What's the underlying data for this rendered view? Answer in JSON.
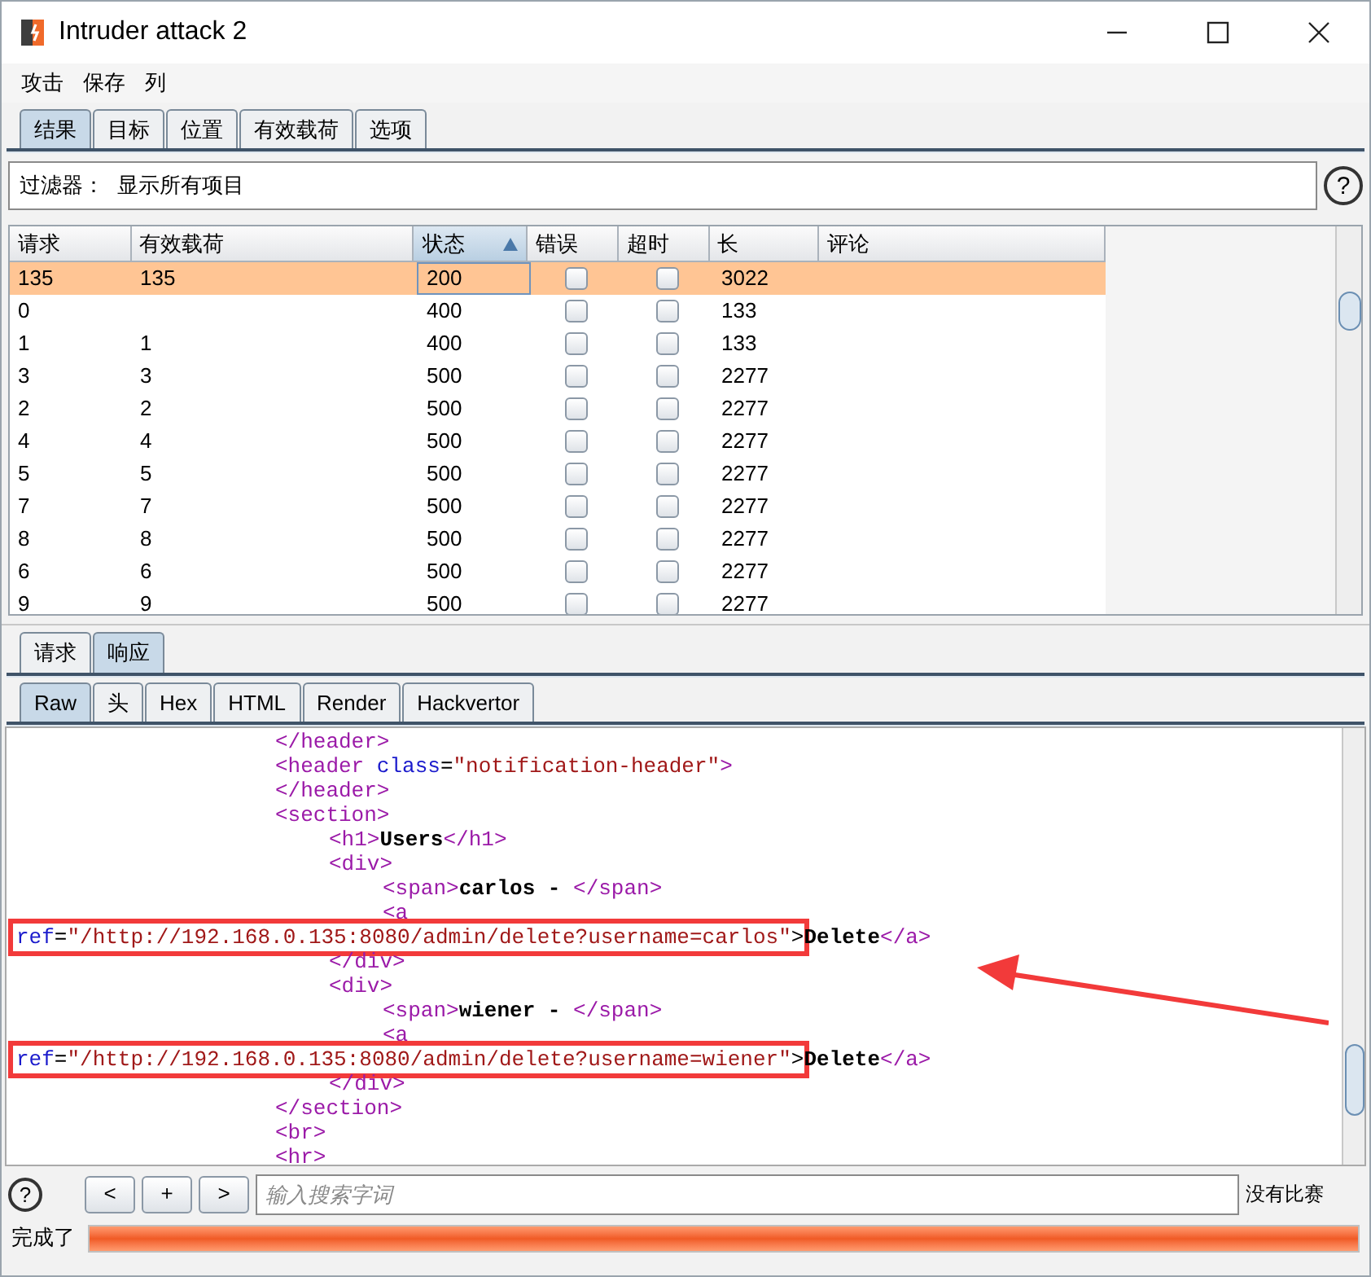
{
  "window": {
    "title": "Intruder attack 2"
  },
  "menu": [
    "攻击",
    "保存",
    "列"
  ],
  "main_tabs": [
    {
      "label": "结果",
      "selected": true
    },
    {
      "label": "目标",
      "selected": false
    },
    {
      "label": "位置",
      "selected": false
    },
    {
      "label": "有效载荷",
      "selected": false
    },
    {
      "label": "选项",
      "selected": false
    }
  ],
  "filter": {
    "label": "过滤器：",
    "value": "显示所有项目",
    "help": "?"
  },
  "table": {
    "columns": [
      {
        "label": "请求",
        "sorted": false
      },
      {
        "label": "有效载荷",
        "sorted": false
      },
      {
        "label": "状态",
        "sorted": true
      },
      {
        "label": "错误",
        "sorted": false
      },
      {
        "label": "超时",
        "sorted": false
      },
      {
        "label": "长",
        "sorted": false
      },
      {
        "label": "评论",
        "sorted": false
      }
    ],
    "rows": [
      {
        "request": "135",
        "payload": "135",
        "status": "200",
        "error": false,
        "timeout": false,
        "length": "3022",
        "selected": true
      },
      {
        "request": "0",
        "status": "400",
        "error": false,
        "timeout": false,
        "length": "133",
        "selected": false
      },
      {
        "request": "1",
        "payload": "1",
        "status": "400",
        "error": false,
        "timeout": false,
        "length": "133",
        "selected": false
      },
      {
        "request": "3",
        "payload": "3",
        "status": "500",
        "error": false,
        "timeout": false,
        "length": "2277",
        "selected": false
      },
      {
        "request": "2",
        "payload": "2",
        "status": "500",
        "error": false,
        "timeout": false,
        "length": "2277",
        "selected": false
      },
      {
        "request": "4",
        "payload": "4",
        "status": "500",
        "error": false,
        "timeout": false,
        "length": "2277",
        "selected": false
      },
      {
        "request": "5",
        "payload": "5",
        "status": "500",
        "error": false,
        "timeout": false,
        "length": "2277",
        "selected": false
      },
      {
        "request": "7",
        "payload": "7",
        "status": "500",
        "error": false,
        "timeout": false,
        "length": "2277",
        "selected": false
      },
      {
        "request": "8",
        "payload": "8",
        "status": "500",
        "error": false,
        "timeout": false,
        "length": "2277",
        "selected": false
      },
      {
        "request": "6",
        "payload": "6",
        "status": "500",
        "error": false,
        "timeout": false,
        "length": "2277",
        "selected": false
      },
      {
        "request": "9",
        "payload": "9",
        "status": "500",
        "error": false,
        "timeout": false,
        "length": "2277",
        "selected": false
      }
    ]
  },
  "message_tabs": [
    {
      "label": "请求",
      "selected": false
    },
    {
      "label": "响应",
      "selected": true
    }
  ],
  "view_tabs": [
    {
      "label": "Raw",
      "selected": true
    },
    {
      "label": "头",
      "selected": false
    },
    {
      "label": "Hex",
      "selected": false
    },
    {
      "label": "HTML",
      "selected": false
    },
    {
      "label": "Render",
      "selected": false
    },
    {
      "label": "Hackvertor",
      "selected": false
    }
  ],
  "code_lines": [
    {
      "kind": "line",
      "tokens": [
        {
          "kind": "tag",
          "t": "</header>"
        }
      ]
    },
    {
      "kind": "line",
      "tokens": [
        {
          "kind": "tag",
          "t": "<header "
        },
        {
          "kind": "attr",
          "t": "class"
        },
        {
          "kind": "plain",
          "t": "="
        },
        {
          "kind": "value",
          "t": "\"notification-header\""
        },
        {
          "kind": "tag",
          "t": ">"
        }
      ]
    },
    {
      "kind": "line",
      "tokens": [
        {
          "kind": "tag",
          "t": "</header>"
        }
      ]
    },
    {
      "kind": "line",
      "tokens": [
        {
          "kind": "tag",
          "t": "<section>"
        }
      ],
      "children": [
        {
          "tokens": [
            {
              "kind": "tag",
              "t": "<h1>"
            },
            {
              "kind": "bold",
              "t": "Users"
            },
            {
              "kind": "tag",
              "t": "</h1>"
            }
          ]
        },
        {
          "tokens": [
            {
              "kind": "tag",
              "t": "<div>"
            }
          ],
          "children": [
            {
              "tokens": [
                {
                  "kind": "tag",
                  "t": "<span>"
                },
                {
                  "kind": "bold",
                  "t": "carlos - "
                },
                {
                  "kind": "tag",
                  "t": "</span>"
                }
              ]
            },
            {
              "tokens": [
                {
                  "kind": "tag",
                  "t": "<a"
                }
              ]
            }
          ]
        }
      ]
    },
    {
      "kind": "wrap",
      "highlighted": true,
      "tokens": [
        {
          "kind": "attr",
          "t": "ref"
        },
        {
          "kind": "plain",
          "t": "="
        },
        {
          "kind": "value",
          "t": "\"/http://192.168.0.135:8080/admin/delete?username=carlos\""
        },
        {
          "kind": "plain",
          "t": ">"
        },
        {
          "kind": "bold",
          "t": "Delete"
        },
        {
          "kind": "tag",
          "t": "</a>"
        }
      ]
    },
    {
      "kind": "line",
      "children": [
        {
          "tokens": [
            {
              "kind": "tag",
              "t": "</div>"
            }
          ]
        },
        {
          "tokens": [
            {
              "kind": "tag",
              "t": "<div>"
            }
          ],
          "children": [
            {
              "tokens": [
                {
                  "kind": "tag",
                  "t": "<span>"
                },
                {
                  "kind": "bold",
                  "t": "wiener - "
                },
                {
                  "kind": "tag",
                  "t": "</span>"
                }
              ]
            },
            {
              "tokens": [
                {
                  "kind": "tag",
                  "t": "<a"
                }
              ]
            }
          ]
        }
      ]
    },
    {
      "kind": "wrap",
      "highlighted": true,
      "tokens": [
        {
          "kind": "attr",
          "t": "ref"
        },
        {
          "kind": "plain",
          "t": "="
        },
        {
          "kind": "value",
          "t": "\"/http://192.168.0.135:8080/admin/delete?username=wiener\""
        },
        {
          "kind": "plain",
          "t": ">"
        },
        {
          "kind": "bold",
          "t": "Delete"
        },
        {
          "kind": "tag",
          "t": "</a>"
        }
      ]
    },
    {
      "kind": "line",
      "children": [
        {
          "tokens": [
            {
              "kind": "tag",
              "t": "</div>"
            }
          ]
        }
      ]
    },
    {
      "kind": "line",
      "tokens": [
        {
          "kind": "tag",
          "t": "</section>"
        }
      ]
    },
    {
      "kind": "line",
      "tokens": [
        {
          "kind": "tag",
          "t": "<br>"
        }
      ]
    },
    {
      "kind": "line",
      "tokens": [
        {
          "kind": "tag",
          "t": "<hr>"
        }
      ]
    }
  ],
  "search": {
    "help": "?",
    "buttons": [
      "<",
      "+",
      ">"
    ],
    "placeholder": "输入搜索字词",
    "result": "没有比赛"
  },
  "status_bar": {
    "label": "完成了",
    "level": 1
  }
}
